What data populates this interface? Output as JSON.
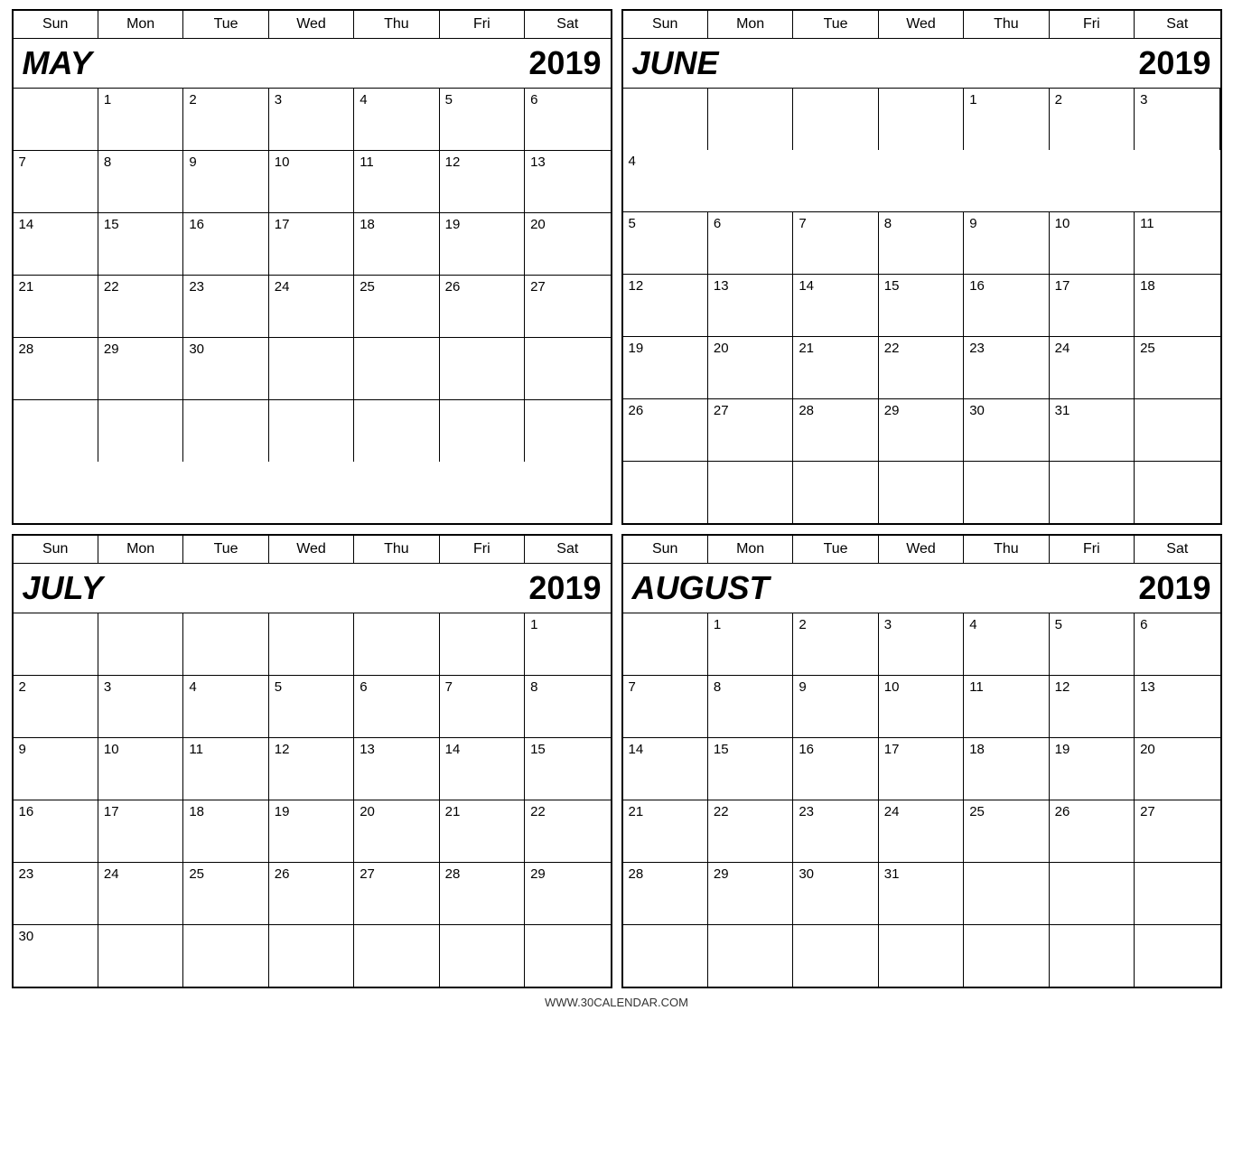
{
  "footer": {
    "url": "WWW.30CALENDAR.COM"
  },
  "calendars": [
    {
      "id": "may-2019",
      "month": "MAY",
      "year": "2019",
      "headers": [
        "Sun",
        "Mon",
        "Tue",
        "Wed",
        "Thu",
        "Fri",
        "Sat"
      ],
      "weeks": [
        [
          "",
          "1",
          "2",
          "3",
          "4",
          "5",
          "6"
        ],
        [
          "7",
          "8",
          "9",
          "10",
          "11",
          "12",
          "13"
        ],
        [
          "14",
          "15",
          "16",
          "17",
          "18",
          "19",
          "20"
        ],
        [
          "21",
          "22",
          "23",
          "24",
          "25",
          "26",
          "27"
        ],
        [
          "28",
          "29",
          "30",
          "",
          "",
          "",
          ""
        ],
        [
          "",
          "",
          "",
          "",
          "",
          "",
          ""
        ]
      ]
    },
    {
      "id": "june-2019",
      "month": "JUNE",
      "year": "2019",
      "headers": [
        "Sun",
        "Mon",
        "Tue",
        "Wed",
        "Thu",
        "Fri",
        "Sat"
      ],
      "weeks": [
        [
          "",
          "",
          "",
          "",
          "1",
          "2",
          "3",
          "4"
        ],
        [
          "5",
          "6",
          "7",
          "8",
          "9",
          "10",
          "11"
        ],
        [
          "12",
          "13",
          "14",
          "15",
          "16",
          "17",
          "18"
        ],
        [
          "19",
          "20",
          "21",
          "22",
          "23",
          "24",
          "25"
        ],
        [
          "26",
          "27",
          "28",
          "29",
          "30",
          "31",
          ""
        ],
        [
          "",
          "",
          "",
          "",
          "",
          "",
          ""
        ]
      ]
    },
    {
      "id": "july-2019",
      "month": "JULY",
      "year": "2019",
      "headers": [
        "Sun",
        "Mon",
        "Tue",
        "Wed",
        "Thu",
        "Fri",
        "Sat"
      ],
      "weeks": [
        [
          "",
          "",
          "",
          "",
          "",
          "",
          "1"
        ],
        [
          "2",
          "3",
          "4",
          "5",
          "6",
          "7",
          "8"
        ],
        [
          "9",
          "10",
          "11",
          "12",
          "13",
          "14",
          "15"
        ],
        [
          "16",
          "17",
          "18",
          "19",
          "20",
          "21",
          "22"
        ],
        [
          "23",
          "24",
          "25",
          "26",
          "27",
          "28",
          "29"
        ],
        [
          "30",
          "",
          "",
          "",
          "",
          "",
          ""
        ]
      ]
    },
    {
      "id": "august-2019",
      "month": "AUGUST",
      "year": "2019",
      "headers": [
        "Sun",
        "Mon",
        "Tue",
        "Wed",
        "Thu",
        "Fri",
        "Sat"
      ],
      "weeks": [
        [
          "",
          "1",
          "2",
          "3",
          "4",
          "5",
          "6"
        ],
        [
          "7",
          "8",
          "9",
          "10",
          "11",
          "12",
          "13"
        ],
        [
          "14",
          "15",
          "16",
          "17",
          "18",
          "19",
          "20"
        ],
        [
          "21",
          "22",
          "23",
          "24",
          "25",
          "26",
          "27"
        ],
        [
          "28",
          "29",
          "30",
          "31",
          "",
          "",
          ""
        ],
        [
          "",
          "",
          "",
          "",
          "",
          "",
          ""
        ]
      ]
    }
  ]
}
